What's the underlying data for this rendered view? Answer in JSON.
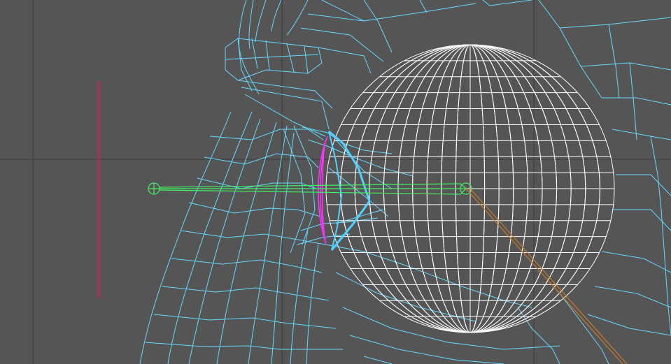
{
  "viewport": {
    "view": "side",
    "mode": "wireframe"
  },
  "colors": {
    "background": "#555555",
    "grid_line": "#3c3c3c",
    "mesh_wire": "#66d9ff",
    "eyeball_wire": "#ffffff",
    "cornea_highlight": "#4fd2ff",
    "iris_edge": "#ff33ff",
    "bone": "#44ee66",
    "locator": "#cc2255",
    "aim_line": "#c77b2a"
  },
  "objects": [
    {
      "name": "face-mesh",
      "type": "polygon-mesh",
      "selected": false
    },
    {
      "name": "eyeball",
      "type": "sphere",
      "selected": false
    },
    {
      "name": "cornea",
      "type": "polygon-mesh",
      "selected": true
    },
    {
      "name": "iris",
      "type": "polygon-mesh",
      "selected": false
    },
    {
      "name": "eye-joint",
      "type": "joint",
      "selected": false
    },
    {
      "name": "locator",
      "type": "locator",
      "selected": false
    },
    {
      "name": "aim-line",
      "type": "guide",
      "selected": false
    }
  ]
}
